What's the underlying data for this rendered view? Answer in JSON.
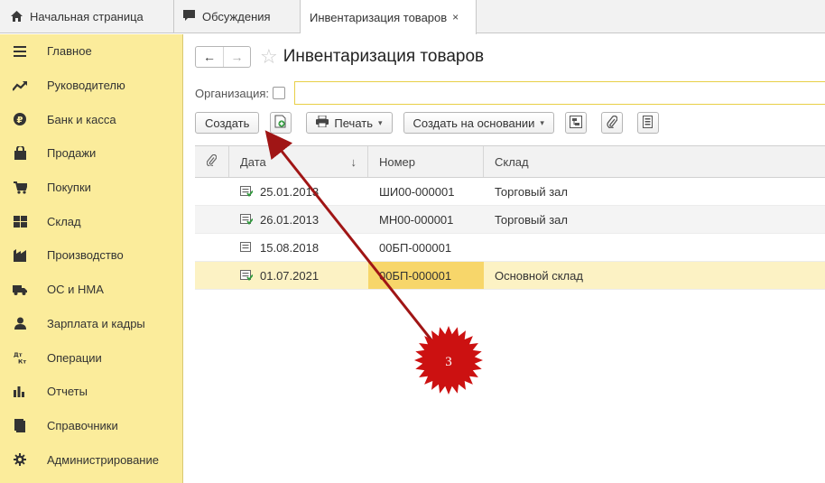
{
  "tabs": [
    {
      "label": "Начальная страница",
      "icon": "home-icon"
    },
    {
      "label": "Обсуждения",
      "icon": "chat-icon"
    },
    {
      "label": "Инвентаризация товаров",
      "icon": "close-icon",
      "close": "×"
    }
  ],
  "sidebar": {
    "items": [
      {
        "label": "Главное",
        "icon": "menu-icon"
      },
      {
        "label": "Руководителю",
        "icon": "trend-icon"
      },
      {
        "label": "Банк и касса",
        "icon": "ruble-icon"
      },
      {
        "label": "Продажи",
        "icon": "bag-icon"
      },
      {
        "label": "Покупки",
        "icon": "cart-icon"
      },
      {
        "label": "Склад",
        "icon": "warehouse-icon"
      },
      {
        "label": "Производство",
        "icon": "factory-icon"
      },
      {
        "label": "ОС и НМА",
        "icon": "truck-icon"
      },
      {
        "label": "Зарплата и кадры",
        "icon": "person-icon"
      },
      {
        "label": "Операции",
        "icon": "dt-kt-icon",
        "icon_text": "Дт Кт"
      },
      {
        "label": "Отчеты",
        "icon": "bar-chart-icon"
      },
      {
        "label": "Справочники",
        "icon": "book-icon"
      },
      {
        "label": "Администрирование",
        "icon": "gear-icon"
      }
    ]
  },
  "page": {
    "title": "Инвентаризация товаров",
    "nav_back": "←",
    "nav_forward": "→",
    "star": "☆"
  },
  "filter": {
    "org_label": "Организация:",
    "org_value": ""
  },
  "toolbar": {
    "create_label": "Создать",
    "print_label": "Печать",
    "create_based_label": "Создать на основании",
    "caret": "▾"
  },
  "table": {
    "headers": {
      "attach": "",
      "date": "Дата",
      "sort": "↓",
      "number": "Номер",
      "warehouse": "Склад"
    },
    "rows": [
      {
        "date": "25.01.2013",
        "number": "ШИ00-000001",
        "warehouse": "Торговый зал",
        "posted": true
      },
      {
        "date": "26.01.2013",
        "number": "МН00-000001",
        "warehouse": "Торговый зал",
        "posted": true
      },
      {
        "date": "15.08.2018",
        "number": "00БП-000001",
        "warehouse": "",
        "posted": false
      },
      {
        "date": "01.07.2021",
        "number": "00БП-000001",
        "warehouse": "Основной склад",
        "posted": true
      }
    ]
  },
  "annotation": {
    "badge_text": "3",
    "badge_color": "#cc1111",
    "arrow_color": "#a01515"
  }
}
